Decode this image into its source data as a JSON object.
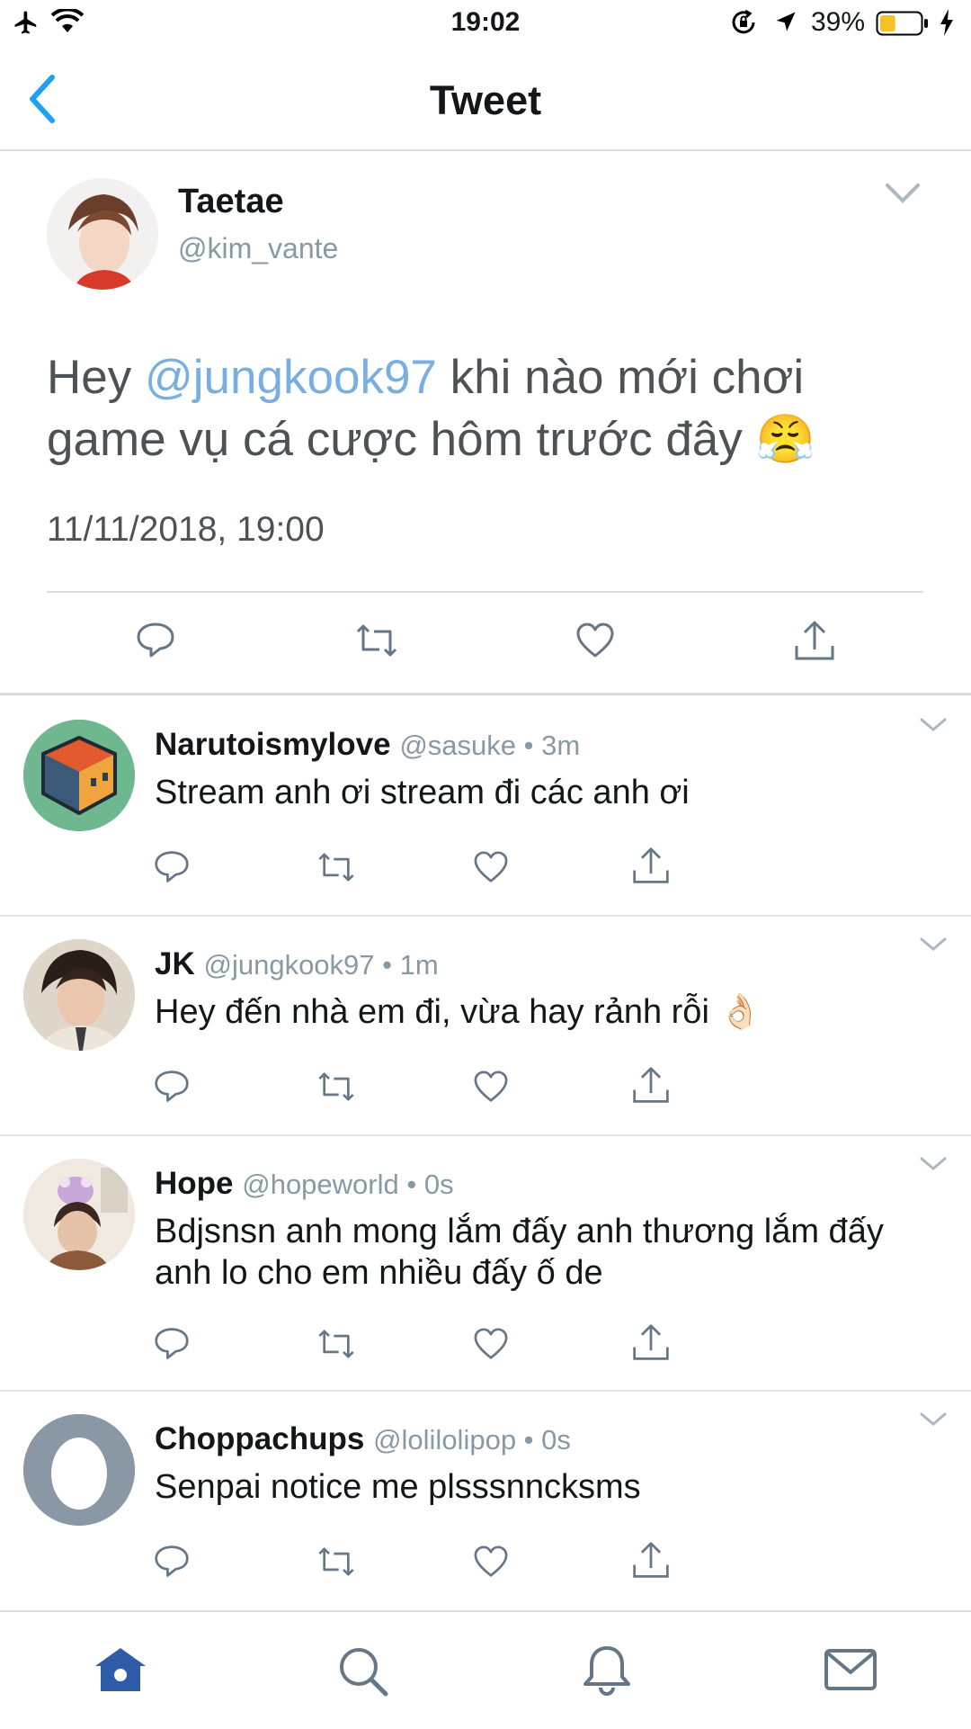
{
  "status_bar": {
    "time": "19:02",
    "battery_percent": "39%",
    "battery_level": 0.39
  },
  "header": {
    "title": "Tweet",
    "back_icon": "chevron-left-icon"
  },
  "main_tweet": {
    "name": "Taetae",
    "handle": "@kim_vante",
    "text_before": "Hey ",
    "mention": "@jungkook97",
    "text_after": " khi nào mới chơi game vụ cá cược hôm trước đây 😤",
    "timestamp": "11/11/2018, 19:00"
  },
  "replies": [
    {
      "name": "Narutoismylove",
      "meta": "@sasuke • 3m",
      "text": "Stream anh ơi stream đi các anh ơi"
    },
    {
      "name": "JK",
      "meta": "@jungkook97 • 1m",
      "text": "Hey đến nhà em đi, vừa hay rảnh rỗi 👌🏻"
    },
    {
      "name": "Hope",
      "meta": "@hopeworld • 0s",
      "text": "Bdjsnsn anh mong lắm đấy anh thương lắm đấy anh lo cho em nhiều đấy ố de"
    },
    {
      "name": "Choppachups",
      "meta": "@lolilolipop • 0s",
      "text": "Senpai notice me plsssnncksms"
    }
  ],
  "tab_bar": {
    "active_tab": "home",
    "icons": [
      "home-icon",
      "search-icon",
      "bell-icon",
      "mail-icon"
    ]
  },
  "colors": {
    "accent": "#1da1f2",
    "mention": "#79aee0",
    "icon_gray": "#657786",
    "tab_active": "#2e5ca8",
    "battery": "#f6c026"
  }
}
